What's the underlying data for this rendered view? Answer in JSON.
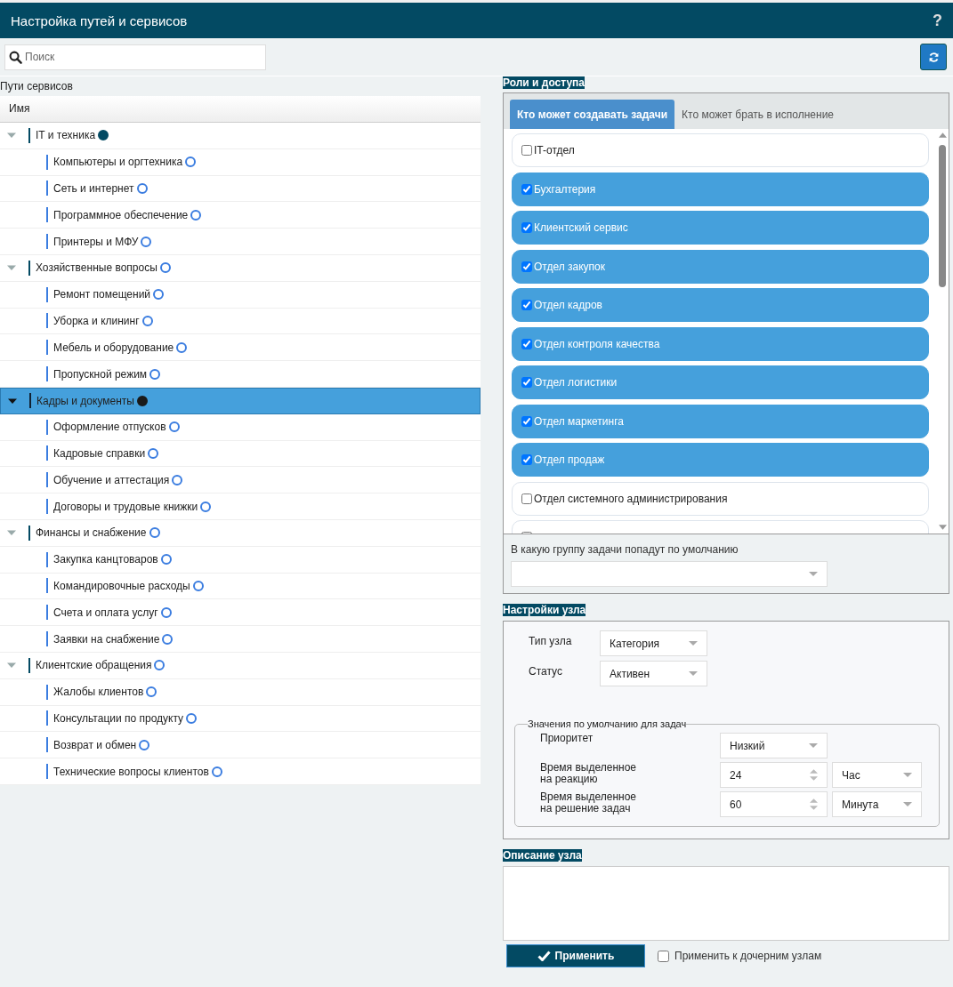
{
  "window": {
    "title": "Настройка путей и сервисов",
    "help": "?"
  },
  "search": {
    "placeholder": "Поиск"
  },
  "tree": {
    "title": "Пути сервисов",
    "column": "Имя",
    "nodes": [
      {
        "label": "IT и техника",
        "filled": true,
        "expanded": true,
        "selected": false,
        "children": [
          {
            "label": "Компьютеры и оргтехника",
            "filled": false,
            "selected": false
          },
          {
            "label": "Сеть и интернет",
            "filled": false,
            "selected": false
          },
          {
            "label": "Программное обеспечение",
            "filled": false,
            "selected": false
          },
          {
            "label": "Принтеры и МФУ",
            "filled": false,
            "selected": false
          }
        ]
      },
      {
        "label": "Хозяйственные вопросы",
        "filled": false,
        "expanded": true,
        "selected": false,
        "children": [
          {
            "label": "Ремонт помещений",
            "filled": false,
            "selected": false
          },
          {
            "label": "Уборка и клининг",
            "filled": false,
            "selected": false
          },
          {
            "label": "Мебель и оборудование",
            "filled": false,
            "selected": false
          },
          {
            "label": "Пропускной режим",
            "filled": false,
            "selected": false
          }
        ]
      },
      {
        "label": "Кадры и документы",
        "filled": true,
        "expanded": true,
        "selected": true,
        "children": [
          {
            "label": "Оформление отпусков",
            "filled": false,
            "selected": false
          },
          {
            "label": "Кадровые справки",
            "filled": false,
            "selected": false
          },
          {
            "label": "Обучение и аттестация",
            "filled": false,
            "selected": false
          },
          {
            "label": "Договоры и трудовые книжки",
            "filled": false,
            "selected": false
          }
        ]
      },
      {
        "label": "Финансы и снабжение",
        "filled": false,
        "expanded": true,
        "selected": false,
        "children": [
          {
            "label": "Закупка канцтоваров",
            "filled": false,
            "selected": false
          },
          {
            "label": "Командировочные расходы",
            "filled": false,
            "selected": false
          },
          {
            "label": "Счета и оплата услуг",
            "filled": false,
            "selected": false
          },
          {
            "label": "Заявки на снабжение",
            "filled": false,
            "selected": false
          }
        ]
      },
      {
        "label": "Клиентские обращения",
        "filled": false,
        "expanded": true,
        "selected": false,
        "children": [
          {
            "label": "Жалобы клиентов",
            "filled": false,
            "selected": false
          },
          {
            "label": "Консультации по продукту",
            "filled": false,
            "selected": false
          },
          {
            "label": "Возврат и обмен",
            "filled": false,
            "selected": false
          },
          {
            "label": "Технические вопросы клиентов",
            "filled": false,
            "selected": false
          }
        ]
      }
    ]
  },
  "roles": {
    "title": "Роли и доступа",
    "tabs": [
      {
        "label": "Кто может создавать задачи",
        "selected": true
      },
      {
        "label": "Кто может брать в исполнение",
        "selected": false
      }
    ],
    "items": [
      {
        "label": "IT-отдел",
        "checked": false
      },
      {
        "label": "Бухгалтерия",
        "checked": true
      },
      {
        "label": "Клиентский сервис",
        "checked": true
      },
      {
        "label": "Отдел закупок",
        "checked": true
      },
      {
        "label": "Отдел кадров",
        "checked": true
      },
      {
        "label": "Отдел контроля качества",
        "checked": true
      },
      {
        "label": "Отдел логистики",
        "checked": true
      },
      {
        "label": "Отдел маркетинга",
        "checked": true
      },
      {
        "label": "Отдел продаж",
        "checked": true
      },
      {
        "label": "Отдел системного администрирования",
        "checked": false
      },
      {
        "checked": false
      }
    ],
    "default_group_label": "В какую группу задачи попадут по умолчанию"
  },
  "node_settings": {
    "title": "Настройки узла",
    "type_label": "Тип узла",
    "type_value": "Категория",
    "status_label": "Статус",
    "status_value": "Активен",
    "defaults": {
      "legend": "Значения по умолчанию для задач",
      "priority_label": "Приоритет",
      "priority_value": "Низкий",
      "reaction_label": [
        "Время выделенное",
        "на реакцию"
      ],
      "reaction_value": "24",
      "reaction_unit": "Час",
      "solve_label": [
        "Время выделенное",
        "на решение задач"
      ],
      "solve_value": "60",
      "solve_unit": "Минута"
    }
  },
  "description": {
    "title": "Описание узла"
  },
  "apply": {
    "label": "Применить",
    "children_label": "Применить к дочерним узлам",
    "children_checked": false
  }
}
